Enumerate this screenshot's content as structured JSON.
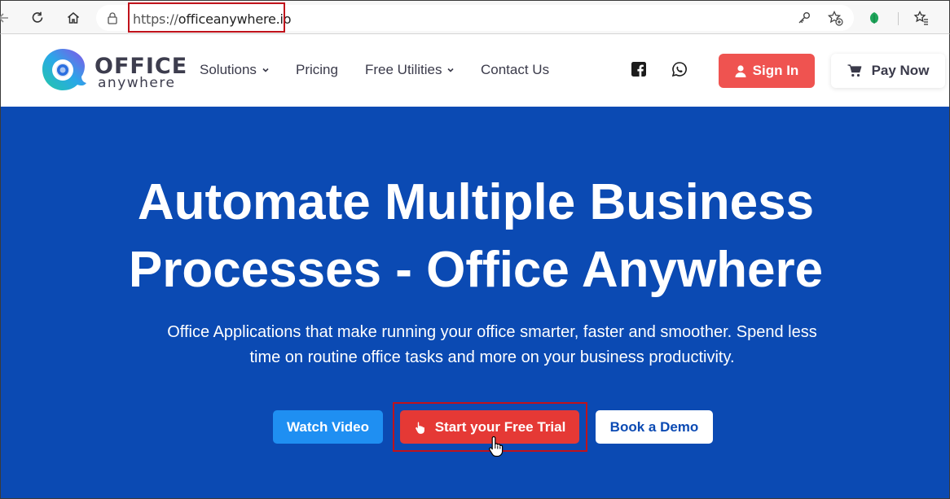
{
  "browser": {
    "url_scheme": "https://",
    "url_host": "officeanywhere.io",
    "icons": {
      "back": "back-arrow-icon",
      "reload": "reload-icon",
      "home": "home-icon",
      "lock": "lock-icon",
      "key": "key-icon",
      "add_favorite": "star-add-icon",
      "extension": "leaf-extension-icon",
      "favorites": "favorites-icon"
    }
  },
  "header": {
    "logo": {
      "word1": "OFFICE",
      "word2": "anywhere"
    },
    "nav": [
      {
        "label": "Solutions",
        "dropdown": true
      },
      {
        "label": "Pricing",
        "dropdown": false
      },
      {
        "label": "Free Utilities",
        "dropdown": true
      },
      {
        "label": "Contact Us",
        "dropdown": false
      }
    ],
    "social": [
      "facebook-icon",
      "whatsapp-icon"
    ],
    "signin_label": "Sign In",
    "paynow_label": "Pay Now"
  },
  "hero": {
    "title_line1": "Automate Multiple Business",
    "title_line2": "Processes - Office Anywhere",
    "subtitle_line1": "Office Applications that make running your office smarter, faster and smoother. Spend less",
    "subtitle_line2": "time on routine office tasks and more on your business productivity.",
    "watch_label": "Watch Video",
    "trial_label": "Start your Free Trial",
    "demo_label": "Book a Demo"
  },
  "colors": {
    "hero_bg": "#0b4ab3",
    "signin_bg": "#ef5350",
    "trial_bg": "#e53935",
    "watch_bg": "#1f8ff2",
    "highlight_box": "#c0121b"
  }
}
